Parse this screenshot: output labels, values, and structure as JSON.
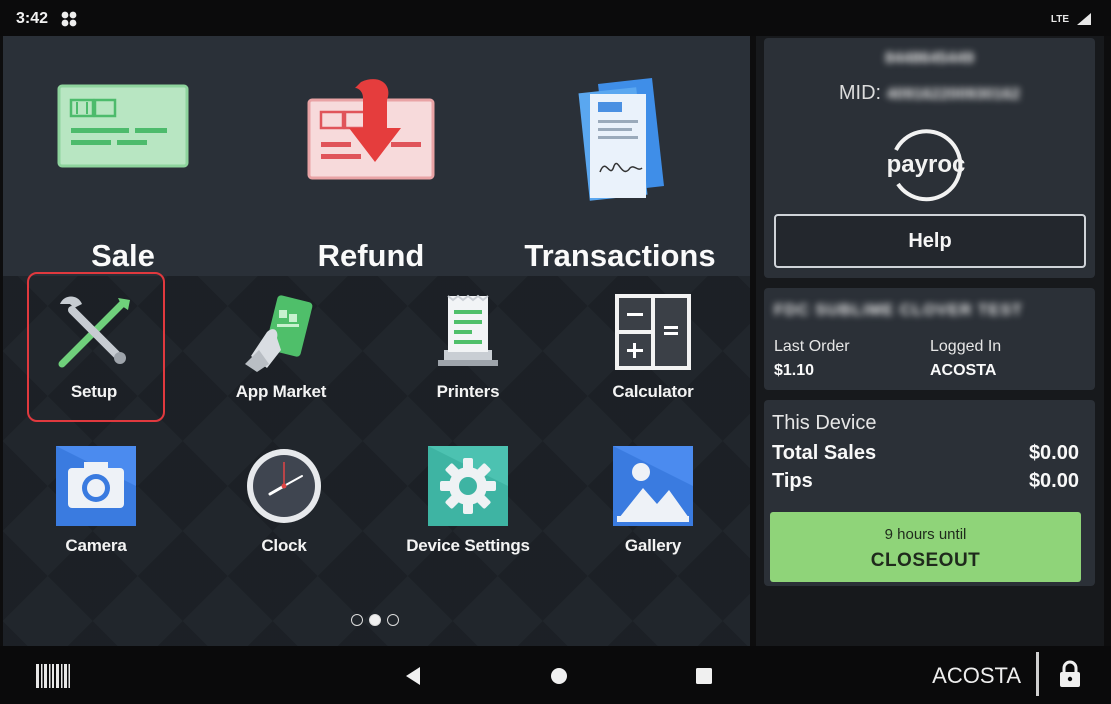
{
  "status_bar": {
    "time": "3:42",
    "network": "LTE"
  },
  "launcher": {
    "primary_tiles": [
      {
        "label": "Sale",
        "icon": "credit-card-icon"
      },
      {
        "label": "Refund",
        "icon": "refund-card-icon"
      },
      {
        "label": "Transactions",
        "icon": "receipt-stack-icon"
      }
    ],
    "apps": [
      {
        "label": "Setup",
        "icon": "wrench-screwdriver-icon",
        "highlighted": true
      },
      {
        "label": "App Market",
        "icon": "hand-phone-icon"
      },
      {
        "label": "Printers",
        "icon": "printer-icon"
      },
      {
        "label": "Calculator",
        "icon": "calculator-icon"
      },
      {
        "label": "Camera",
        "icon": "camera-icon"
      },
      {
        "label": "Clock",
        "icon": "clock-icon"
      },
      {
        "label": "Device Settings",
        "icon": "gear-icon"
      },
      {
        "label": "Gallery",
        "icon": "image-icon"
      }
    ],
    "page_count": 3,
    "current_page": 2
  },
  "merchant_panel": {
    "merchant_id": "8448645449",
    "mid_label": "MID:",
    "mid_value": "409162200930162",
    "logo_text": "payroc",
    "help_label": "Help"
  },
  "order_panel": {
    "merchant_name": "FDC SUBLIME CLOVER TEST",
    "last_order_label": "Last Order",
    "last_order_value": "$1.10",
    "logged_in_label": "Logged In",
    "logged_in_value": "ACOSTA"
  },
  "device_panel": {
    "title": "This Device",
    "total_sales_label": "Total Sales",
    "total_sales_value": "$0.00",
    "tips_label": "Tips",
    "tips_value": "$0.00",
    "closeout_sub": "9 hours until",
    "closeout_label": "CLOSEOUT",
    "closeout_color": "#8fd479"
  },
  "nav_bar": {
    "user": "ACOSTA"
  },
  "colors": {
    "highlight": "#e0393e",
    "panel": "#2b3037"
  }
}
